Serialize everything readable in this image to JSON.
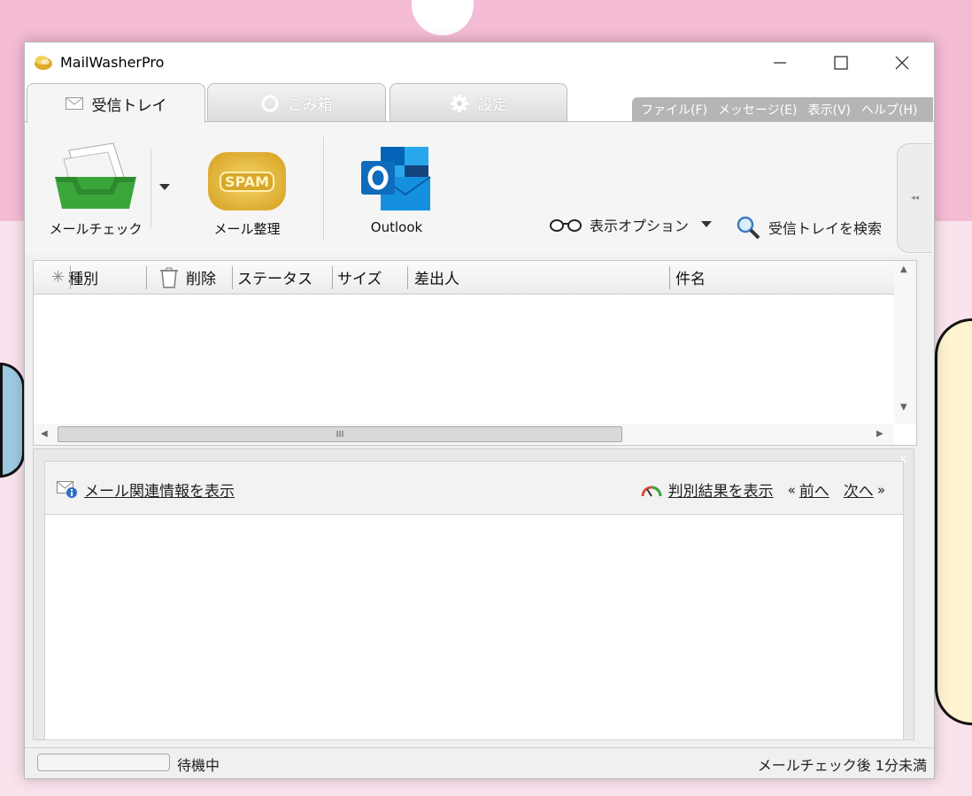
{
  "window": {
    "title": "MailWasherPro"
  },
  "tabs": [
    {
      "label": "受信トレイ",
      "icon": "envelope-icon",
      "active": true
    },
    {
      "label": "ごみ箱",
      "icon": "recycle-icon",
      "active": false
    },
    {
      "label": "設定",
      "icon": "gear-icon",
      "active": false
    }
  ],
  "menu": {
    "file": "ファイル(F)",
    "message": "メッセージ(E)",
    "view": "表示(V)",
    "help": "ヘルプ(H)"
  },
  "ribbon": {
    "mail_check": "メールチェック",
    "spam_label": "SPAM",
    "mail_sort": "メール整理",
    "outlook": "Outlook",
    "view_options": "表示オプション",
    "search_inbox": "受信トレイを検索"
  },
  "list": {
    "columns": {
      "type": "種別",
      "delete": "削除",
      "status": "ステータス",
      "size": "サイズ",
      "sender": "差出人",
      "subject": "件名"
    },
    "rows": [],
    "hscroll_grip": "III"
  },
  "preview": {
    "mail_info_link": "メール関連情報を表示",
    "result_link": "判別結果を表示",
    "prev_link": "前へ",
    "next_link": "次へ",
    "prev_marker": "«",
    "next_marker": "»",
    "close_glyph": "x"
  },
  "status": {
    "state": "待機中",
    "last_check": "メールチェック後 1分未満"
  },
  "colors": {
    "accent_green": "#3aa63a",
    "spam_gold": "#e2b530",
    "outlook_blue": "#0f6cbd",
    "desktop_pink": "#f6c8dc"
  }
}
